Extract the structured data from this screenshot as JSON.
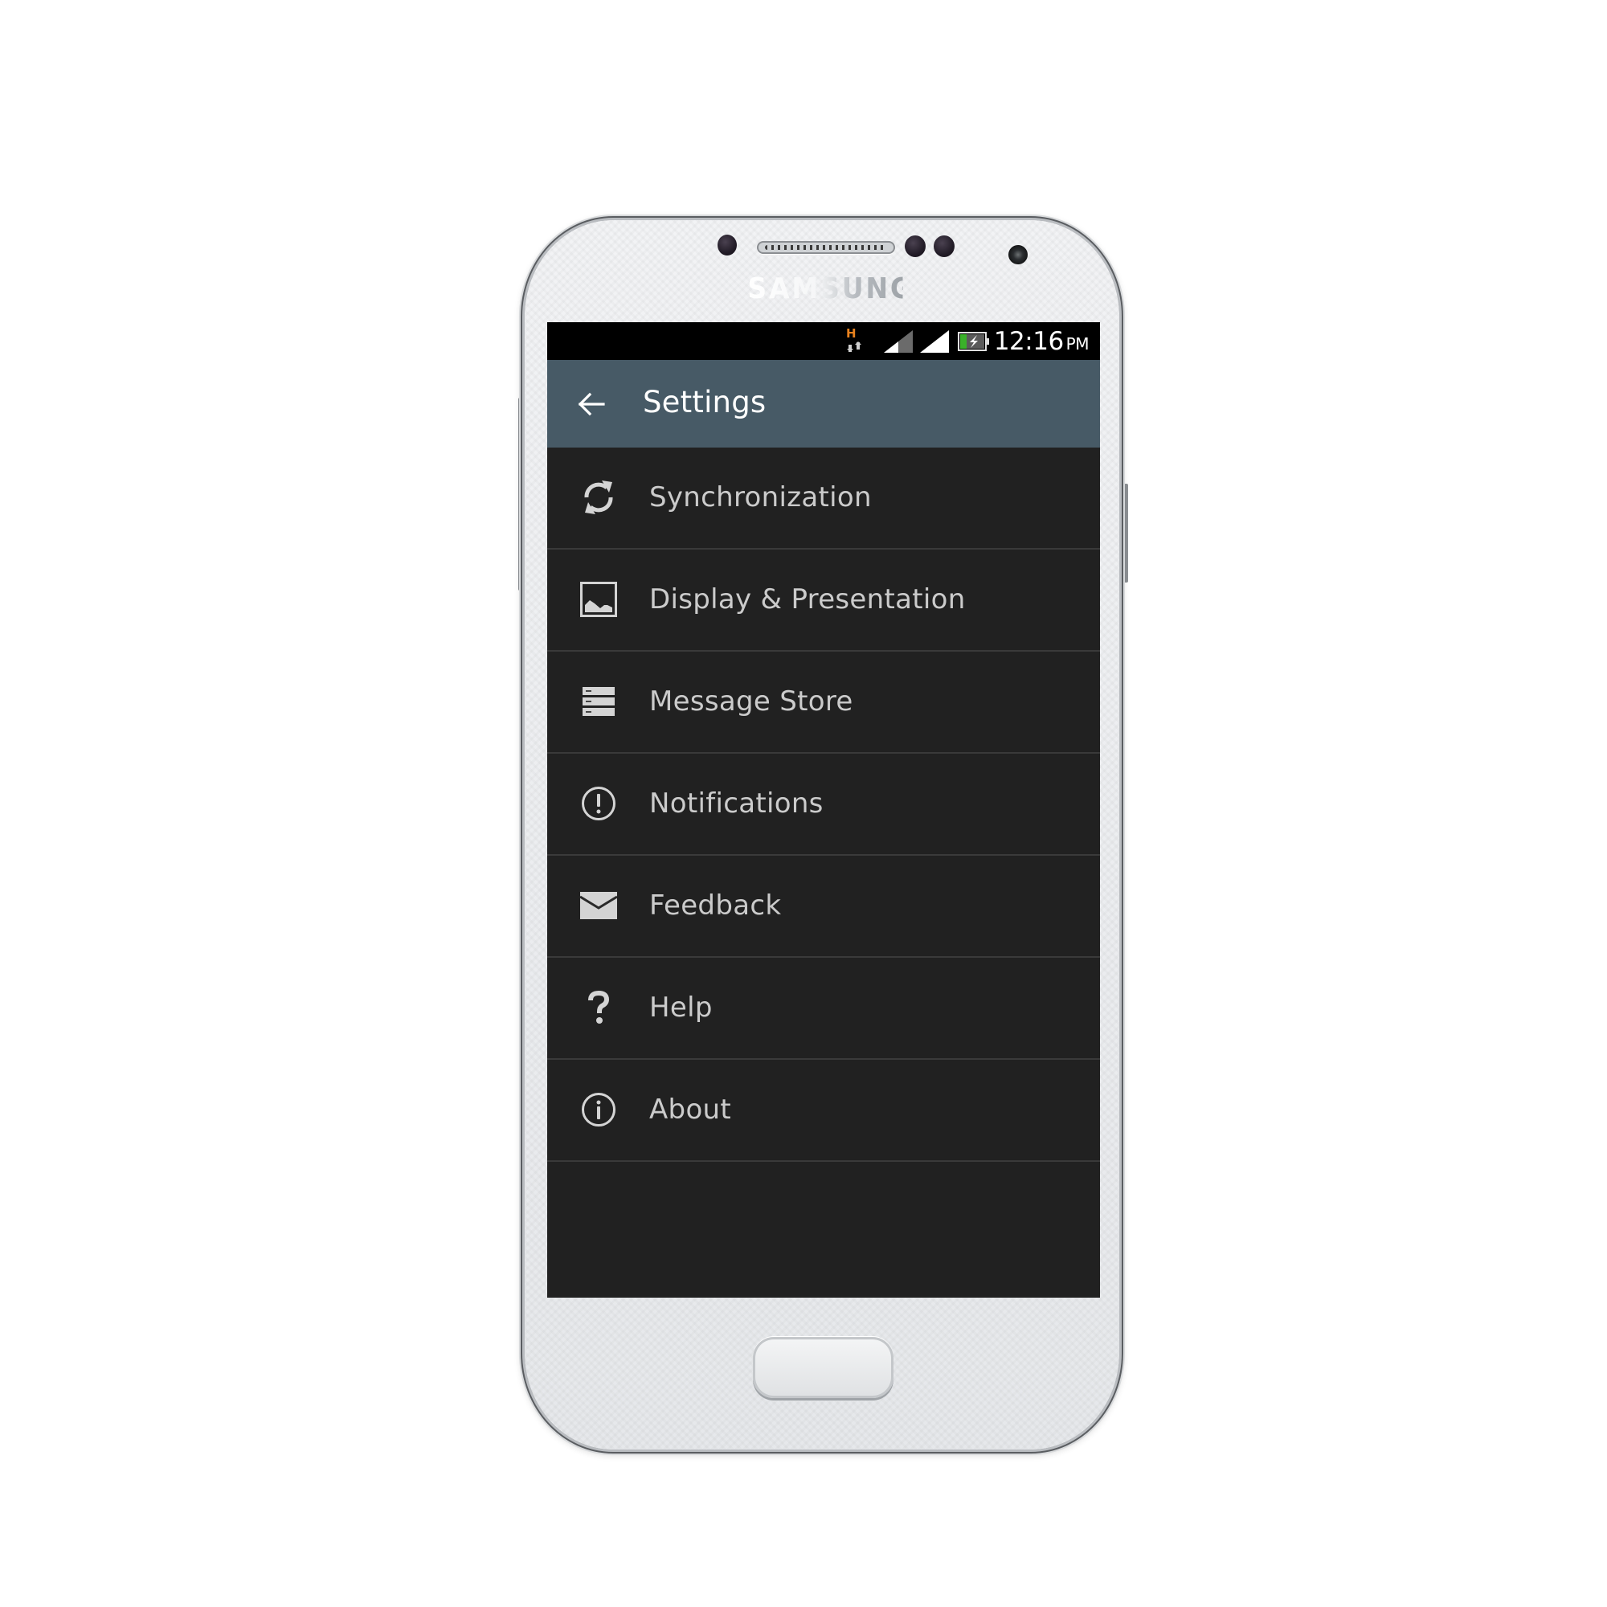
{
  "device": {
    "brand_label": "SAMSUNG"
  },
  "status_bar": {
    "network_type": "H",
    "time": "12:16",
    "ampm": "PM",
    "icons": [
      "network-h-icon",
      "signal-strength-partial-icon",
      "signal-strength-full-icon",
      "battery-charging-icon"
    ],
    "colors": {
      "background": "#000000",
      "network_type": "#e8821e",
      "battery_fill": "#3ab02a"
    }
  },
  "app_bar": {
    "title": "Settings",
    "back_icon": "arrow-left-icon",
    "background": "#475a66"
  },
  "menu": {
    "background": "#212121",
    "text_color": "#cbcbcb",
    "divider_color": "#3a3a3a",
    "items": [
      {
        "label": "Synchronization",
        "icon": "sync-icon"
      },
      {
        "label": "Display & Presentation",
        "icon": "image-icon"
      },
      {
        "label": "Message Store",
        "icon": "storage-icon"
      },
      {
        "label": "Notifications",
        "icon": "alert-circle-icon"
      },
      {
        "label": "Feedback",
        "icon": "mail-icon"
      },
      {
        "label": "Help",
        "icon": "help-icon"
      },
      {
        "label": "About",
        "icon": "info-icon"
      }
    ]
  }
}
